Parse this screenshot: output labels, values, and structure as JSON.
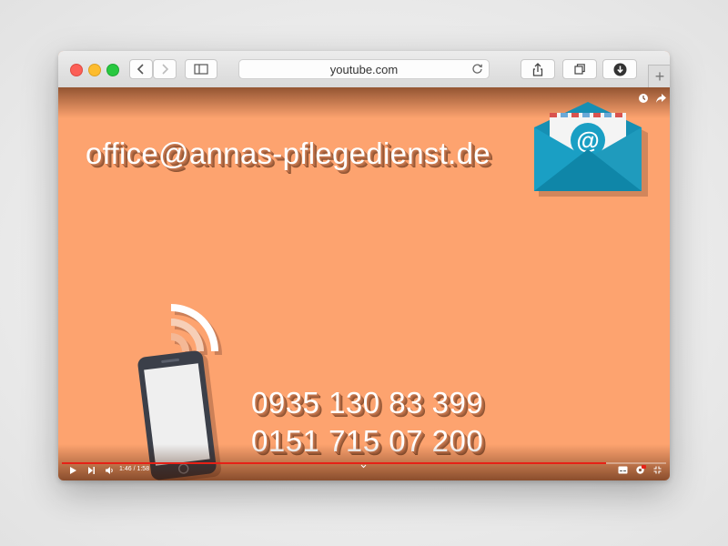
{
  "browser": {
    "address": "youtube.com",
    "newtab_label": "+"
  },
  "video": {
    "email": "office@annas-pflegedienst.de",
    "phone1": "0935 130 83 399",
    "phone2": "0151 715 07 200",
    "time": "1:46 / 1:58",
    "progress": 0.9
  },
  "colors": {
    "background": "#fda36f",
    "envelope": "#1a9fc4",
    "progress": "#e62117"
  }
}
